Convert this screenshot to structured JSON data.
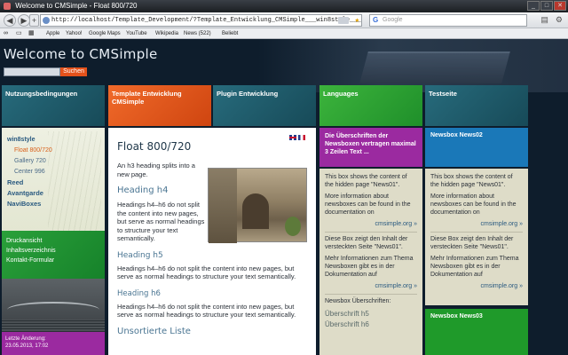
{
  "window": {
    "title": "Welcome to CMSimple - Float 800/720"
  },
  "browser": {
    "url": "http://localhost/Template_Development/?Template_Entwicklung_CMSimple___win8style___Float_800%2F720",
    "search_placeholder": "Google",
    "bookmarks": [
      "Apple",
      "Yahoo!",
      "Google Maps",
      "YouTube",
      "Wikipedia",
      "News (522)",
      "Beliebt"
    ]
  },
  "site": {
    "title": "Welcome to CMSimple",
    "search_button": "Suchen"
  },
  "nav_tiles": [
    {
      "label": "Nutzungsbedingungen",
      "color": "#1f5d6e"
    },
    {
      "label": "Template Entwicklung CMSimple",
      "color": "#e4551a"
    },
    {
      "label": "Plugin Entwicklung",
      "color": "#1f5d6e"
    },
    {
      "label": "Languages",
      "color": "#2fa52f"
    },
    {
      "label": "Testseite",
      "color": "#1f5d6e"
    }
  ],
  "sidebar": {
    "head": "win8style",
    "items": [
      "Float 800/720",
      "Gallery 720",
      "Center 996"
    ],
    "main_items": [
      "Reed",
      "Avantgarde",
      "NaviBoxes"
    ],
    "green_items": [
      "Druckansicht",
      "Inhaltsverzeichnis",
      "Kontakt-Formular"
    ],
    "last_change_label": "Letzte Änderung:",
    "last_change_value": "23.05.2013, 17:02"
  },
  "content": {
    "title": "Float 800/720",
    "intro": "An h3 heading splits into a new page.",
    "h4": "Heading h4",
    "p4": "Headings h4–h6 do not split the content into new pages, but serve as normal headings to structure your text semantically.",
    "h5": "Heading h5",
    "p5": "Headings h4–h6 do not split the content into new pages, but serve as normal headings to structure your text semantically.",
    "h6": "Heading h6",
    "p6": "Headings h4–h6 do not split the content into new pages, but serve as normal headings to structure your text semantically.",
    "list_heading": "Unsortierte Liste"
  },
  "newsbox1": {
    "header": "Die Überschriften der Newsboxen vertragen maximal 3 Zeilen Text ...",
    "p1": "This box shows the content of the hidden page \"News01\".",
    "p2": "More information about newsboxes can be found in the documentation on",
    "link1": "cmsimple.org »",
    "p3": "Diese Box zeigt den Inhalt der versteckten Seite \"News01\".",
    "p4": "Mehr Informationen zum Thema Newsboxen gibt es in der Dokumentation auf",
    "link2": "cmsimple.org »",
    "label": "Newsbox Überschriften:",
    "h5": "Überschrift h5",
    "h6": "Überschrift h6"
  },
  "newsbox2": {
    "header": "Newsbox News02",
    "p1": "This box shows the content of the hidden page \"News01\".",
    "p2": "More information about newsboxes can be found in the documentation on",
    "link1": "cmsimple.org »",
    "p3": "Diese Box zeigt den Inhalt der versteckten Seite \"News01\".",
    "p4": "Mehr Informationen zum Thema Newsboxen gibt es in der Dokumentation auf",
    "link2": "cmsimple.org »"
  },
  "newsbox3": {
    "header": "Newsbox News03"
  }
}
